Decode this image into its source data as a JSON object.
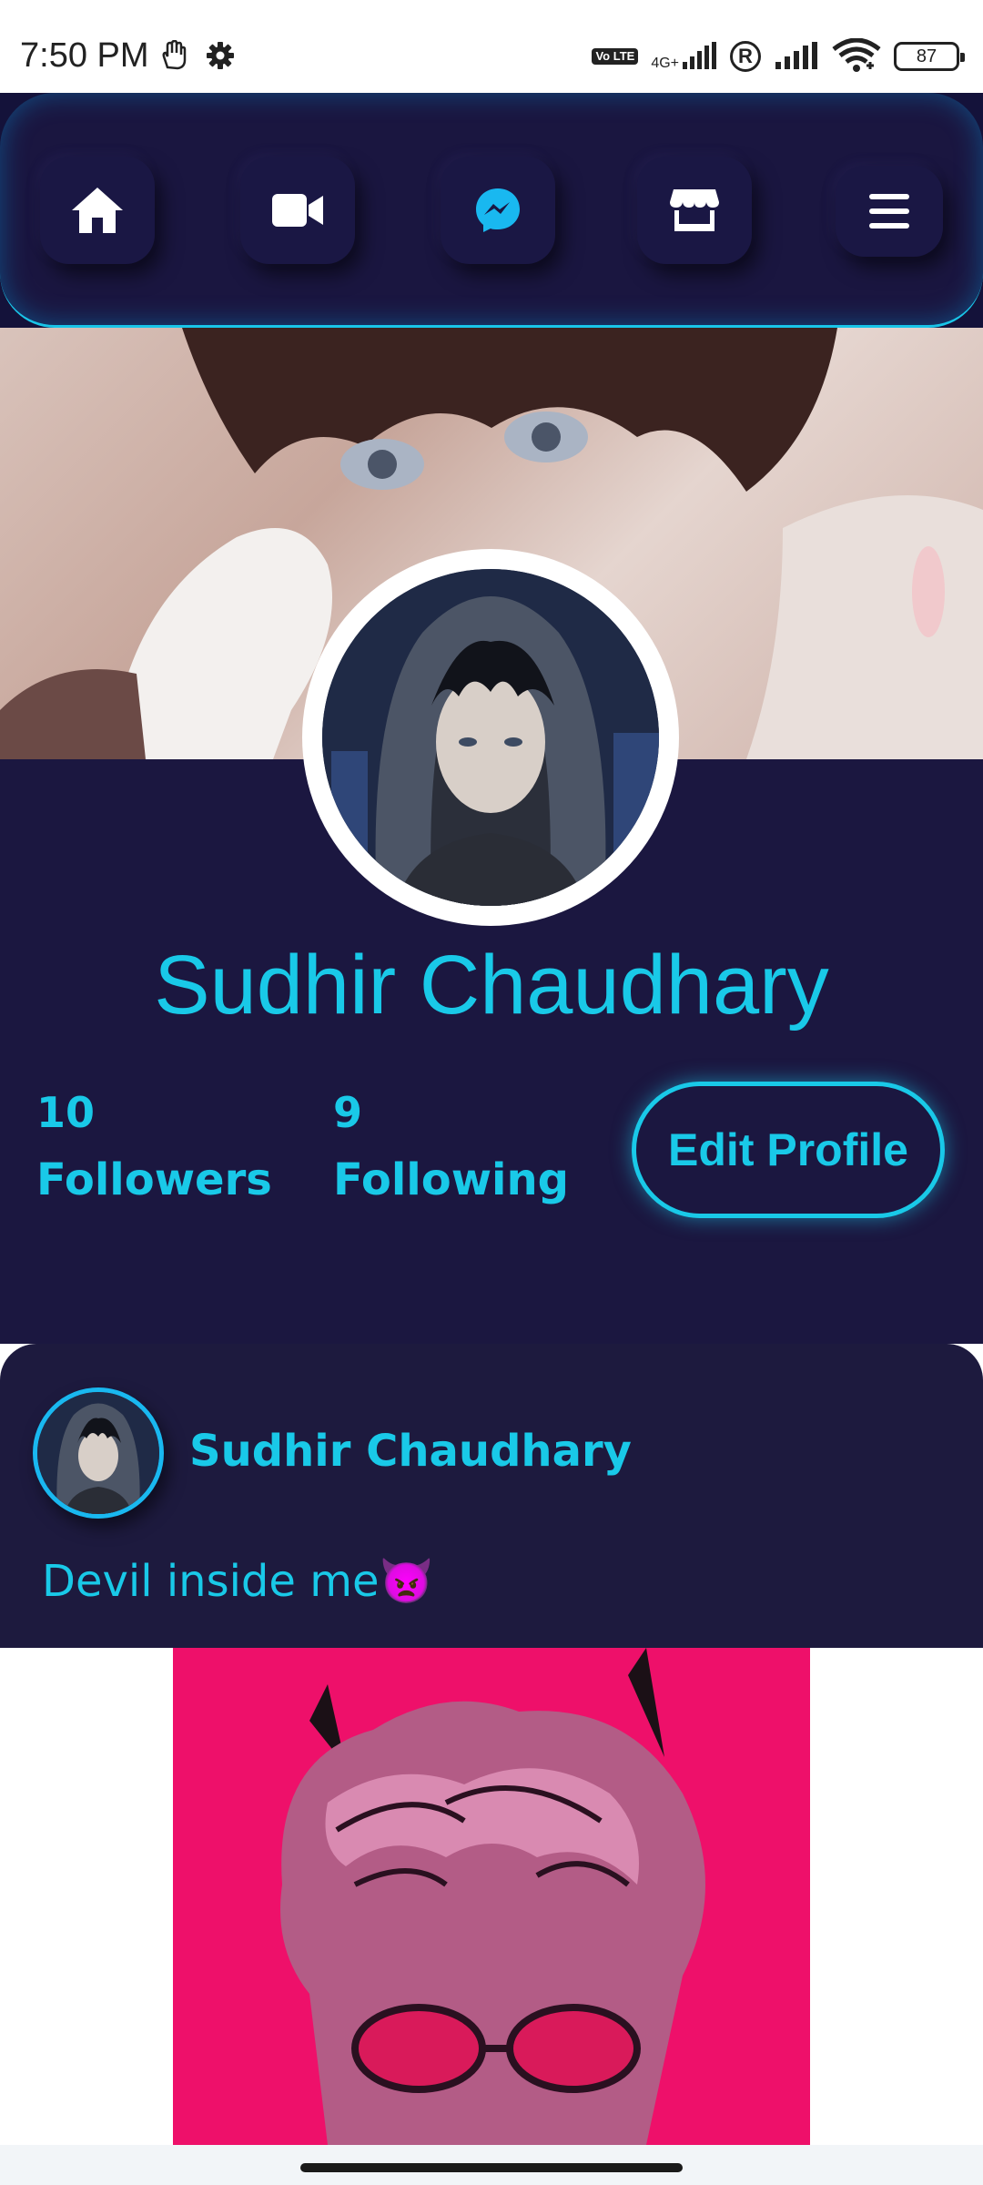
{
  "status_bar": {
    "time": "7:50 PM",
    "network_type": "4G+",
    "volte_label": "Vo LTE",
    "roaming_label": "R",
    "battery_level": "87"
  },
  "nav": {
    "items": [
      {
        "name": "home",
        "icon": "home-icon"
      },
      {
        "name": "videos",
        "icon": "video-camera-icon"
      },
      {
        "name": "messenger",
        "icon": "messenger-icon"
      },
      {
        "name": "marketplace",
        "icon": "store-icon"
      },
      {
        "name": "menu",
        "icon": "hamburger-menu-icon"
      }
    ]
  },
  "profile": {
    "name": "Sudhir Chaudhary",
    "followers_count": "10",
    "followers_label": "Followers",
    "following_count": "9",
    "following_label": "Following",
    "edit_button_label": "Edit Profile"
  },
  "post": {
    "author": "Sudhir Chaudhary",
    "text": "Devil inside me👿"
  },
  "colors": {
    "accent": "#19c9e8",
    "nav_bg": "#14123a",
    "profile_bg": "#1b1740",
    "post_bg": "#1d1a3e",
    "post_image_bg": "#ee106a"
  }
}
